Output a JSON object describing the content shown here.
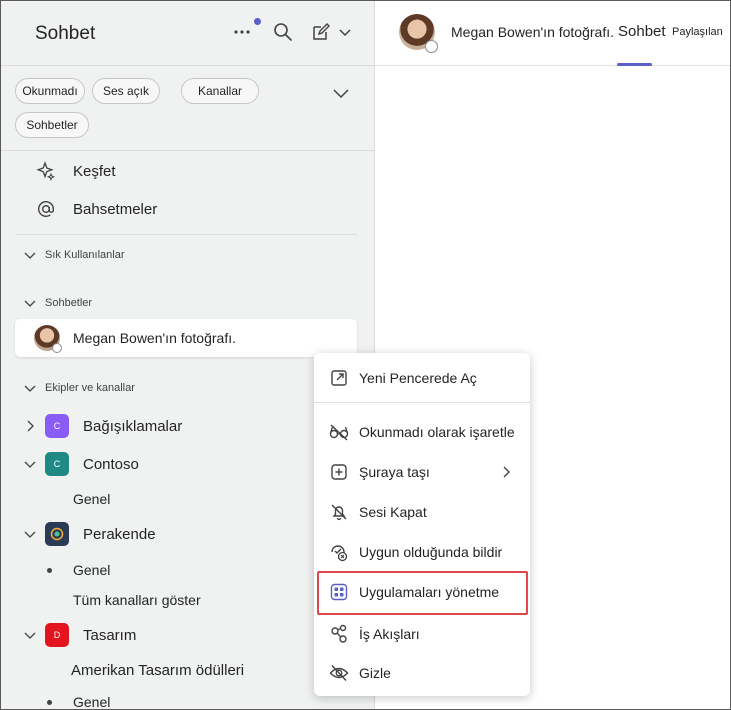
{
  "sidebar": {
    "title": "Sohbet",
    "filters": [
      "Okunmadı",
      "Ses açık",
      "Kanallar",
      "Sohbetler"
    ],
    "nav": [
      {
        "label": "Keşfet",
        "icon": "sparkle-icon"
      },
      {
        "label": "Bahsetmeler",
        "icon": "at-icon"
      }
    ],
    "sections": {
      "favorites": "Sık Kullanılanlar",
      "chats": "Sohbetler",
      "teams": "Ekipler ve kanallar"
    },
    "chat_item": "Megan Bowen'ın fotoğrafı.",
    "teams": [
      {
        "name": "Bağışıklamalar",
        "letter": "C",
        "color": "#8a5cf6"
      },
      {
        "name": "Contoso",
        "letter": "C",
        "color": "#1f8a83"
      },
      {
        "name": "Perakende",
        "letter": "",
        "color": "#2b3a55"
      },
      {
        "name": "Tasarım",
        "letter": "D",
        "color": "#e3141e"
      }
    ],
    "channels": {
      "contoso_general": "Genel",
      "perakende_general": "Genel",
      "show_all": "Tüm kanalları göster",
      "awards": "Amerikan Tasarım ödülleri",
      "tasarim_general": "Genel"
    }
  },
  "chat_header": {
    "name": "Megan Bowen'ın fotoğrafı.",
    "tab_chat": "Sohbet",
    "tab_share": "Paylaşılan"
  },
  "context_menu": {
    "items": [
      {
        "label": "Yeni Pencerede Aç",
        "icon": "open-window-icon"
      },
      {
        "label": "Okunmadı olarak işaretle",
        "icon": "glasses-off-icon"
      },
      {
        "label": "Şuraya taşı",
        "icon": "add-square-icon"
      },
      {
        "label": "Sesi Kapat",
        "icon": "bell-off-icon"
      },
      {
        "label": "Uygun olduğunda bildir",
        "icon": "presence-notify-icon"
      },
      {
        "label": "Uygulamaları yönetme",
        "icon": "apps-icon"
      },
      {
        "label": "İş Akışları",
        "icon": "workflows-icon"
      },
      {
        "label": "Gizle",
        "icon": "eye-off-icon"
      }
    ]
  },
  "colors": {
    "accent": "#5b5fc7",
    "highlight": "#e0474c"
  }
}
